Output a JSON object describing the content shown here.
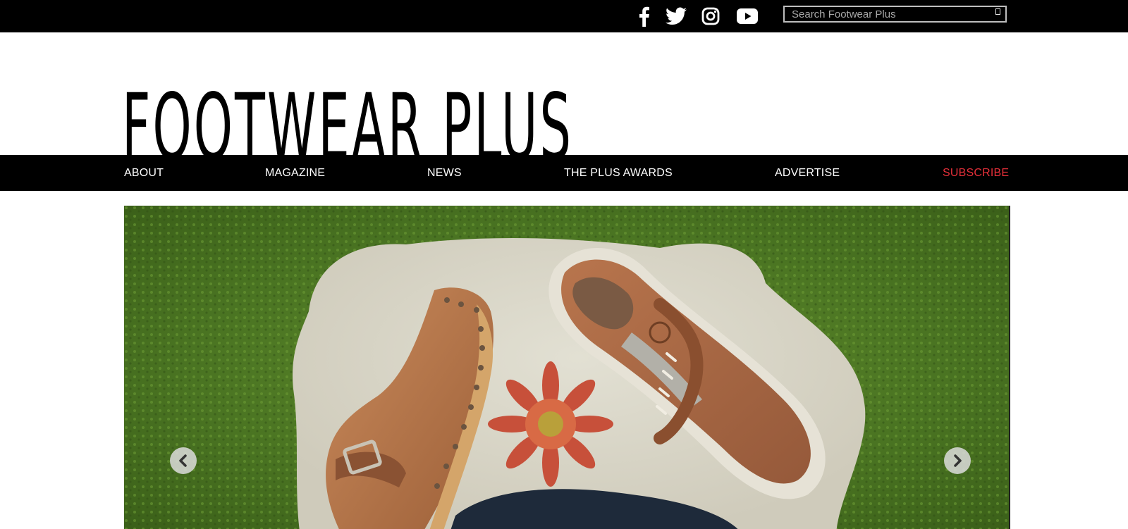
{
  "social": {
    "facebook": "facebook-icon",
    "twitter": "twitter-icon",
    "instagram": "instagram-icon",
    "youtube": "youtube-icon"
  },
  "search": {
    "placeholder": "Search Footwear Plus",
    "button_icon": "search-submit-icon"
  },
  "brand": {
    "logo_text": "FOOTWEAR PLUS"
  },
  "nav": {
    "items": [
      {
        "label": "ABOUT"
      },
      {
        "label": "MAGAZINE"
      },
      {
        "label": "NEWS"
      },
      {
        "label": "THE PLUS AWARDS"
      },
      {
        "label": "ADVERTISE"
      },
      {
        "label": "SUBSCRIBE"
      }
    ]
  },
  "hero": {
    "prev_icon": "chevron-left-icon",
    "next_icon": "chevron-right-icon",
    "image": "shoes-on-moss-photo"
  },
  "colors": {
    "bar_bg": "#000000",
    "nav_text": "#ffffff",
    "subscribe": "#e8303a"
  }
}
